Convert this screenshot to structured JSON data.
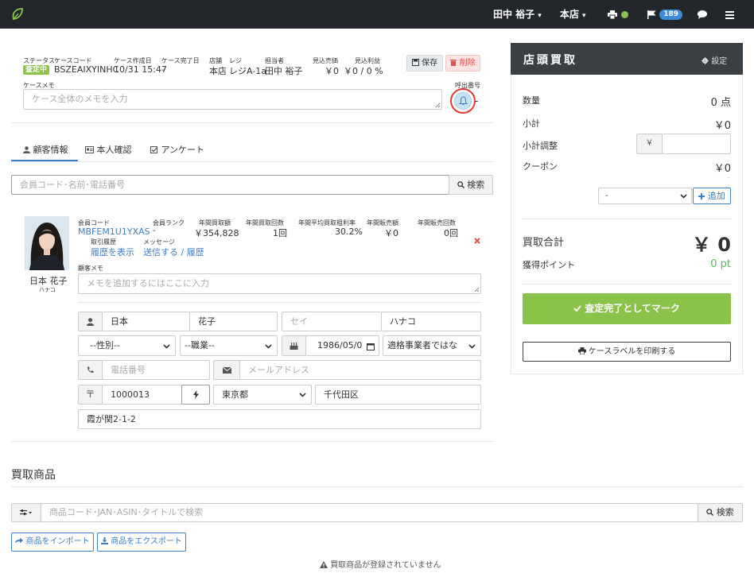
{
  "topbar": {
    "user_name": "田中 裕子",
    "store_name": "本店",
    "notification_count": "189"
  },
  "case": {
    "status_label": "ステータス",
    "status_value": "査定中",
    "code_label": "ケースコード",
    "code_value": "BSZEAIXYINHC",
    "created_label": "ケース作成日",
    "created_value": "10/31 15:47",
    "completed_label": "ケース完了日",
    "completed_value": "-",
    "store_label": "店舗",
    "store_value": "本店",
    "register_label": "レジ",
    "register_value": "レジA-1a",
    "staff_label": "担当者",
    "staff_value": "田中 裕子",
    "est_sales_label": "見込売価",
    "est_sales_value": "￥0",
    "est_profit_label": "見込利益",
    "est_profit_value": "￥0 / 0 %",
    "save_label": "保存",
    "delete_label": "削除",
    "memo_label": "ケースメモ",
    "memo_placeholder": "ケース全体のメモを入力",
    "call_number_label": "呼出番号",
    "call_number_value": "-"
  },
  "tabs": [
    {
      "label": "顧客情報"
    },
    {
      "label": "本人確認"
    },
    {
      "label": "アンケート"
    }
  ],
  "search": {
    "placeholder": "会員コード･名前･電話番号",
    "button_label": "検索"
  },
  "customer": {
    "full_name": "日本 花子",
    "kana_name": "ハナコ",
    "member_code_label": "会員コード",
    "member_code_value": "MBFEM1U1YXAS",
    "rank_label": "会員ランク",
    "rank_value": "-",
    "annual_buy_amount_label": "年間買取額",
    "annual_buy_amount_value": "￥354,828",
    "annual_buy_count_label": "年間買取回数",
    "annual_buy_count_value": "1回",
    "annual_margin_label": "年間平均買取粗利率",
    "annual_margin_value": "30.2%",
    "annual_sales_amount_label": "年間販売額",
    "annual_sales_amount_value": "￥0",
    "annual_sales_count_label": "年間販売回数",
    "annual_sales_count_value": "0回",
    "history_label": "取引履歴",
    "history_link": "履歴を表示",
    "message_label": "メッセージ",
    "message_send": "送信する",
    "message_sep": " / ",
    "message_history": "履歴",
    "memo_label": "顧客メモ",
    "memo_placeholder": "メモを追加するにはここに入力"
  },
  "form": {
    "last_name": "日本",
    "first_name": "花子",
    "last_kana_placeholder": "セイ",
    "first_kana": "ハナコ",
    "gender": "--性別--",
    "job": "--職業--",
    "birthday": "1986/05/0",
    "qualified": "適格事業者ではな",
    "phone_placeholder": "電話番号",
    "email_placeholder": "メールアドレス",
    "postal_code": "1000013",
    "prefecture": "東京都",
    "city": "千代田区",
    "address": "霞が関2-1-2"
  },
  "items": {
    "section_title": "買取商品",
    "search_placeholder": "商品コード･JAN･ASIN･タイトルで検索",
    "search_button": "検索",
    "import_label": "商品をインポート",
    "export_label": "商品をエクスポート",
    "empty_message": "買取商品が登録されていません"
  },
  "sidebar": {
    "title": "店頭買取",
    "settings_label": "設定",
    "qty_label": "数量",
    "qty_value": "0 点",
    "subtotal_label": "小計",
    "subtotal_value": "￥0",
    "adjust_label": "小計調整",
    "adjust_prefix": "￥",
    "coupon_label": "クーポン",
    "coupon_value": "￥0",
    "coupon_dash": "-",
    "coupon_select": "-",
    "add_label": "追加",
    "total_label": "買取合計",
    "total_value": "￥ 0",
    "points_label": "獲得ポイント",
    "points_value": "0 pt",
    "complete_label": "査定完了としてマーク",
    "print_label": "ケースラベルを印刷する"
  },
  "colors": {
    "topbar": "#23272b",
    "status_green": "#8bc34a",
    "primary_button": "#8bc34a",
    "link_blue": "#3d7fc4",
    "delete_red": "#d9534f",
    "points_green": "#5cb85c",
    "sidebar_header": "#3a3f44"
  }
}
